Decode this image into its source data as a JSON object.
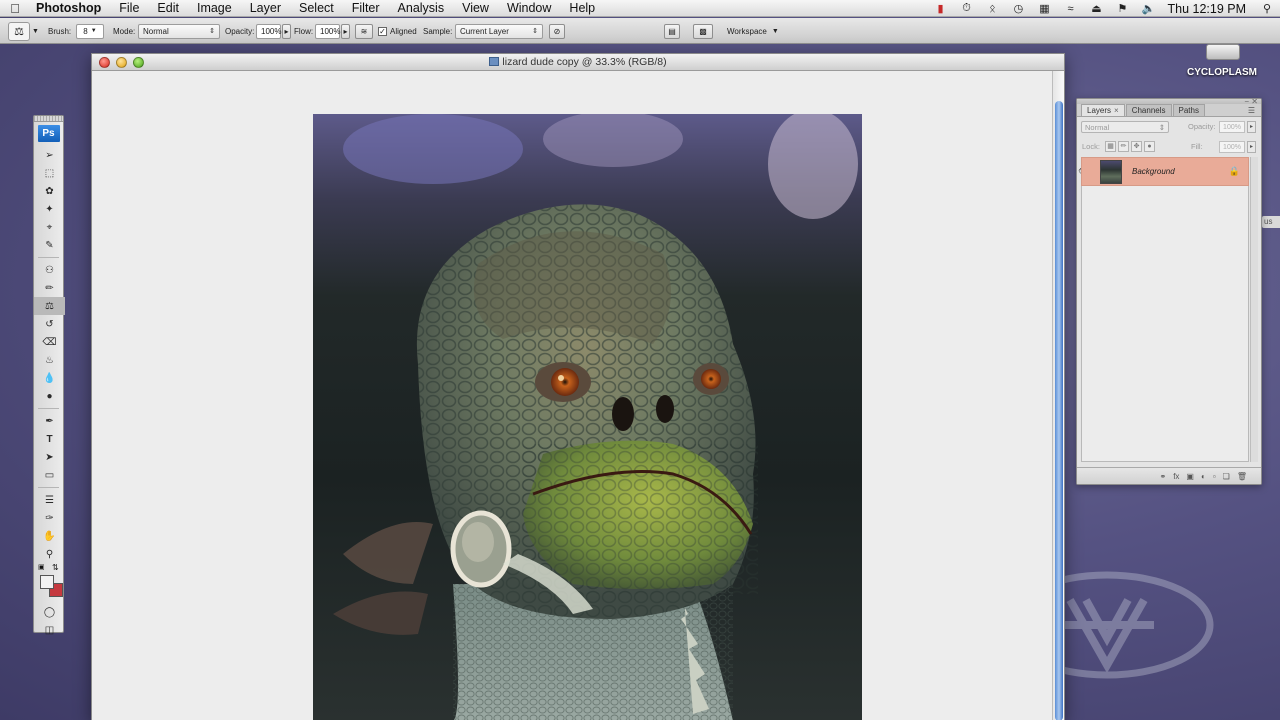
{
  "menubar": {
    "apple_icon": "apple-icon",
    "app_name": "Photoshop",
    "items": [
      "File",
      "Edit",
      "Image",
      "Layer",
      "Select",
      "Filter",
      "Analysis",
      "View",
      "Window",
      "Help"
    ],
    "clock": "Thu 12:19 PM",
    "status_icons": [
      "adobe-updater-icon",
      "time-machine-icon",
      "bluetooth-icon",
      "clock-icon",
      "script-icon",
      "wifi-icon",
      "eject-icon",
      "flag-icon",
      "volume-icon"
    ]
  },
  "options": {
    "brush_label": "Brush:",
    "brush_size": "8",
    "mode_label": "Mode:",
    "mode_value": "Normal",
    "opacity_label": "Opacity:",
    "opacity_value": "100%",
    "flow_label": "Flow:",
    "flow_value": "100%",
    "aligned_label": "Aligned",
    "aligned_checked": "✓",
    "sample_label": "Sample:",
    "sample_value": "Current Layer",
    "workspace_label": "Workspace"
  },
  "document": {
    "title": "lizard dude copy @ 33.3% (RGB/8)"
  },
  "layers_panel": {
    "tabs": [
      "Layers",
      "Channels",
      "Paths"
    ],
    "blend_mode": "Normal",
    "opacity_label": "Opacity:",
    "opacity_value": "100%",
    "lock_label": "Lock:",
    "fill_label": "Fill:",
    "fill_value": "100%",
    "layer_name": "Background"
  },
  "desktop": {
    "drive_label": "CYCLOPLASM",
    "edge_label": "us"
  },
  "colors": {
    "foreground": "#f2f2f2",
    "background": "#c5393f",
    "layer_selected": "#e9ab98",
    "ps_logo": "#1f6fcf"
  }
}
